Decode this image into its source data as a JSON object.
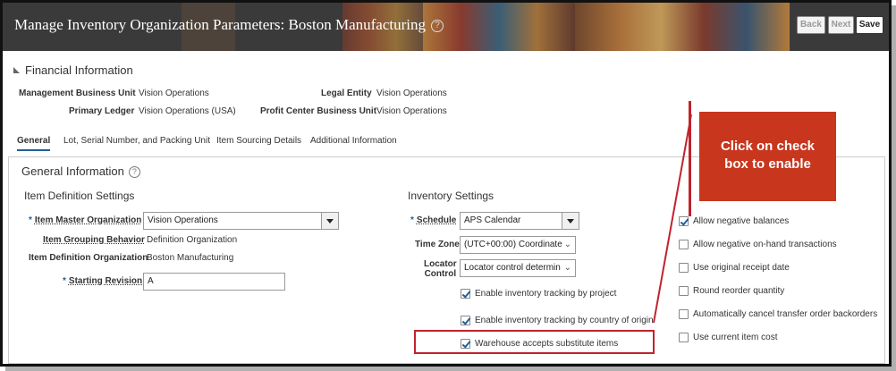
{
  "header": {
    "title": "Manage Inventory Organization Parameters: Boston Manufacturing",
    "help_icon": "?",
    "back_label": "Back",
    "next_label": "Next",
    "save_label": "Save"
  },
  "financial": {
    "title": "Financial Information",
    "management_bu_label": "Management Business Unit",
    "management_bu_value": "Vision Operations",
    "legal_entity_label": "Legal Entity",
    "legal_entity_value": "Vision Operations",
    "primary_ledger_label": "Primary Ledger",
    "primary_ledger_value": "Vision Operations (USA)",
    "profit_center_label": "Profit Center Business Unit",
    "profit_center_value": "Vision Operations"
  },
  "tabs": [
    {
      "label": "General"
    },
    {
      "label": "Lot, Serial Number, and Packing Unit"
    },
    {
      "label": "Item Sourcing Details"
    },
    {
      "label": "Additional Information"
    }
  ],
  "general": {
    "title": "General Information",
    "help_icon": "?",
    "item_definition": {
      "title": "Item Definition Settings",
      "required_marker": "*",
      "master_org_label": "Item Master Organization",
      "master_org_value": "Vision Operations",
      "grouping_label": "Item Grouping Behavior",
      "grouping_value": "Definition Organization",
      "def_org_label": "Item Definition Organization",
      "def_org_value": "Boston Manufacturing",
      "starting_revision_label": "Starting Revision",
      "starting_revision_value": "A"
    },
    "inventory": {
      "title": "Inventory Settings",
      "required_marker": "*",
      "schedule_label": "Schedule",
      "schedule_value": "APS Calendar",
      "timezone_label": "Time Zone",
      "timezone_value": "(UTC+00:00) Coordinate",
      "locator_label_1": "Locator",
      "locator_label_2": "Control",
      "locator_value": "Locator control determin",
      "checkboxes": [
        {
          "label": "Enable inventory tracking by project",
          "checked": true
        },
        {
          "label": "Enable inventory tracking by country of origin",
          "checked": true
        },
        {
          "label": "Warehouse accepts substitute items",
          "checked": true
        }
      ]
    },
    "right_options": [
      {
        "label": "Allow negative balances",
        "checked": true
      },
      {
        "label": "Allow negative on-hand transactions",
        "checked": false
      },
      {
        "label": "Use original receipt date",
        "checked": false
      },
      {
        "label": "Round reorder quantity",
        "checked": false
      },
      {
        "label": "Automatically cancel transfer order backorders",
        "checked": false
      },
      {
        "label": "Use current item cost",
        "checked": false
      }
    ]
  },
  "callout": {
    "line1": "Click on check",
    "line2": "box to enable",
    "color": "#c8361d"
  }
}
